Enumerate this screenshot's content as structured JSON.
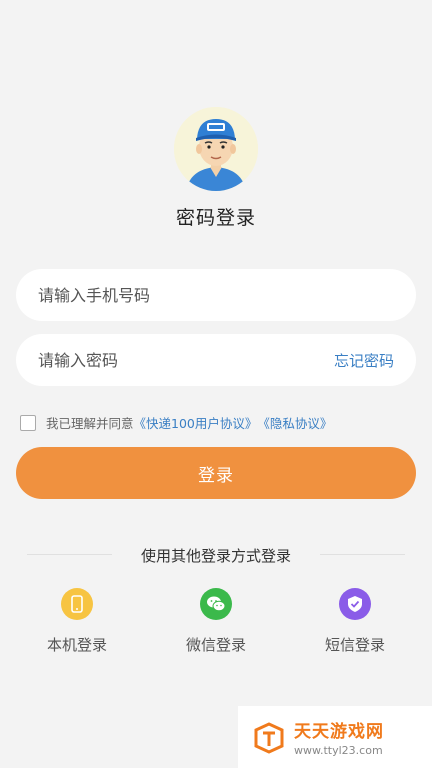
{
  "page": {
    "title": "密码登录"
  },
  "form": {
    "phone_placeholder": "请输入手机号码",
    "password_placeholder": "请输入密码",
    "forgot_label": "忘记密码",
    "agree_prefix": "我已理解并同意",
    "agree_link1": "《快递100用户协议》",
    "agree_link2": "《隐私协议》",
    "checked": false,
    "login_label": "登录"
  },
  "other_login": {
    "heading": "使用其他登录方式登录",
    "options": [
      {
        "label": "本机登录",
        "icon": "phone-icon",
        "color": "#f7c442"
      },
      {
        "label": "微信登录",
        "icon": "wechat-icon",
        "color": "#3bb94b"
      },
      {
        "label": "短信登录",
        "icon": "shield-icon",
        "color": "#8a5ce8"
      }
    ]
  },
  "watermark": {
    "title": "天天游戏网",
    "url": "www.ttyl23.com"
  },
  "colors": {
    "accent": "#f0913f",
    "link": "#3a7fc4"
  }
}
